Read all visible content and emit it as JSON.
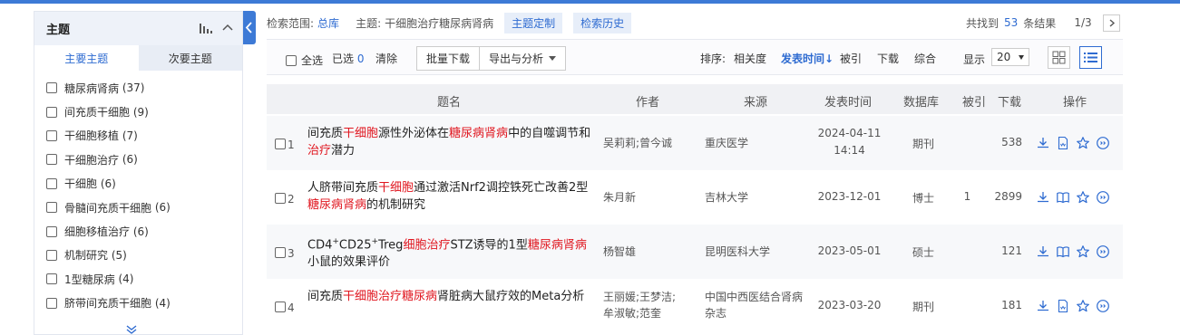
{
  "sidebar": {
    "title": "主题",
    "tabs": [
      "主要主题",
      "次要主题"
    ],
    "items": [
      {
        "label": "糖尿病肾病",
        "count": "(37)"
      },
      {
        "label": "间充质干细胞",
        "count": "(9)"
      },
      {
        "label": "干细胞移植",
        "count": "(7)"
      },
      {
        "label": "干细胞治疗",
        "count": "(6)"
      },
      {
        "label": "干细胞",
        "count": "(6)"
      },
      {
        "label": "骨髓间充质干细胞",
        "count": "(6)"
      },
      {
        "label": "细胞移植治疗",
        "count": "(6)"
      },
      {
        "label": "机制研究",
        "count": "(5)"
      },
      {
        "label": "1型糖尿病",
        "count": "(4)"
      },
      {
        "label": "脐带间充质干细胞",
        "count": "(4)"
      }
    ]
  },
  "scope": {
    "label": "检索范围:",
    "value": "总库",
    "topic_label": "主题:",
    "topic_value": "干细胞治疗糖尿病肾病",
    "custom_btn": "主题定制",
    "history_btn": "检索历史"
  },
  "results": {
    "found_prefix": "共找到",
    "found_count": "53",
    "found_suffix": "条结果",
    "page": "1/3"
  },
  "toolbar": {
    "select_all": "全选",
    "selected_label": "已选",
    "selected_count": "0",
    "clear": "清除",
    "batch_download": "批量下载",
    "export": "导出与分析",
    "sort_label": "排序:",
    "sort_relevance": "相关度",
    "sort_date": "发表时间",
    "sort_cite": "被引",
    "sort_download": "下载",
    "sort_overall": "综合",
    "show_label": "显示",
    "show_value": "20"
  },
  "table": {
    "headers": [
      "题名",
      "作者",
      "来源",
      "发表时间",
      "数据库",
      "被引",
      "下载",
      "操作"
    ],
    "rows": [
      {
        "idx": "1",
        "author": "吴莉莉;曾今诚",
        "source": "重庆医学",
        "date": "2024-04-11",
        "time": "14:14",
        "db": "期刊",
        "cite": "",
        "download": "538"
      },
      {
        "idx": "2",
        "author": "朱月新",
        "source": "吉林大学",
        "date": "2023-12-01",
        "time": "",
        "db": "博士",
        "cite": "1",
        "download": "2899"
      },
      {
        "idx": "3",
        "author": "杨智雄",
        "source": "昆明医科大学",
        "date": "2023-05-01",
        "time": "",
        "db": "硕士",
        "cite": "",
        "download": "121"
      },
      {
        "idx": "4",
        "author": "王丽媛;王梦洁;牟淑敏;范奎",
        "source": "中国中西医结合肾病杂志",
        "date": "2023-03-20",
        "time": "",
        "db": "期刊",
        "cite": "",
        "download": "181"
      }
    ],
    "titles": [
      [
        "间充质",
        "干细胞",
        "源性外泌体在",
        "糖尿病肾病",
        "中的自噬调节和",
        "治疗",
        "潜力"
      ],
      [
        "人脐带间充质",
        "干细胞",
        "通过激活Nrf2调控铁死亡改善2型",
        "糖尿病肾病",
        "的机制研究"
      ],
      [
        "CD4",
        "+",
        "CD25",
        "+",
        "Treg",
        "细胞治疗",
        "STZ诱导的1型",
        "糖尿病肾病",
        "小鼠的效果评价"
      ],
      [
        "间充质",
        "干细胞治疗糖尿病",
        "肾脏病大鼠疗效的Meta分析"
      ]
    ]
  },
  "colors": {
    "accent": "#2e6bd1",
    "highlight": "#e0161f",
    "header_bg": "#eef2f9"
  }
}
